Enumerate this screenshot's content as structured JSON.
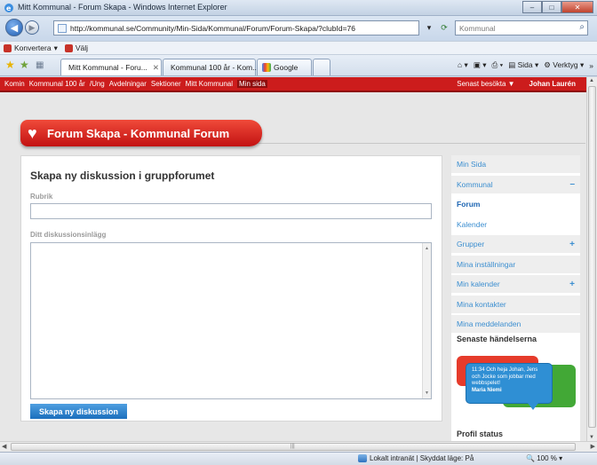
{
  "window": {
    "title": "Mitt Kommunal - Forum Skapa - Windows Internet Explorer"
  },
  "address": {
    "url": "http://kommunal.se/Community/Min-Sida/Kommunal/Forum/Forum-Skapa/?clubId=76",
    "search_placeholder": "Kommunal"
  },
  "menubar": {
    "items": [
      "Konvertera",
      "Välj"
    ]
  },
  "tabs": [
    {
      "label": "Mitt Kommunal - Foru...",
      "active": true
    },
    {
      "label": "Kommunal 100 år - Kom...",
      "active": false
    },
    {
      "label": "Google",
      "active": false
    }
  ],
  "commandbar": {
    "page_label": "Sida",
    "tools_label": "Verktyg"
  },
  "sitenav": {
    "items": [
      "Komin",
      "Kommunal 100 år",
      "/Ung",
      "Avdelningar",
      "Sektioner",
      "Mitt Kommunal",
      "Min sida"
    ],
    "active_index": 6,
    "recent_label": "Senast besökta ▼",
    "user_name": "Johan Laurén"
  },
  "banner": {
    "title": "Forum Skapa - Kommunal Forum"
  },
  "form": {
    "heading": "Skapa ny diskussion i gruppforumet",
    "subject_label": "Rubrik",
    "subject_value": "",
    "body_label": "Ditt diskussionsinlägg",
    "body_value": "",
    "submit_label": "Skapa ny diskussion"
  },
  "sidebar": {
    "items": [
      {
        "label": "Min Sida",
        "toggle": "",
        "style": "grey"
      },
      {
        "label": "Kommunal",
        "toggle": "–",
        "style": "grey"
      },
      {
        "label": "Forum",
        "toggle": "",
        "style": "active"
      },
      {
        "label": "Kalender",
        "toggle": "",
        "style": "plain"
      },
      {
        "label": "Grupper",
        "toggle": "+",
        "style": "grey"
      },
      {
        "label": "Mina inställningar",
        "toggle": "",
        "style": "grey"
      },
      {
        "label": "Min kalender",
        "toggle": "+",
        "style": "grey"
      },
      {
        "label": "Mina kontakter",
        "toggle": "",
        "style": "grey"
      },
      {
        "label": "Mina meddelanden",
        "toggle": "",
        "style": "grey"
      }
    ],
    "events_heading": "Senaste händelserna",
    "bubble_text": "11:34 Och heja Johan, Jens och Jocke som jobbar med webbspelet!",
    "bubble_author": "Maria Niemi",
    "profile_heading": "Profil status"
  },
  "statusbar": {
    "zone": "Lokalt intranät | Skyddat läge: På",
    "zoom": "100 %"
  },
  "colors": {
    "brand_red": "#cc1c1c",
    "link_blue": "#3b8ed0",
    "button_blue": "#1b6fbd"
  }
}
